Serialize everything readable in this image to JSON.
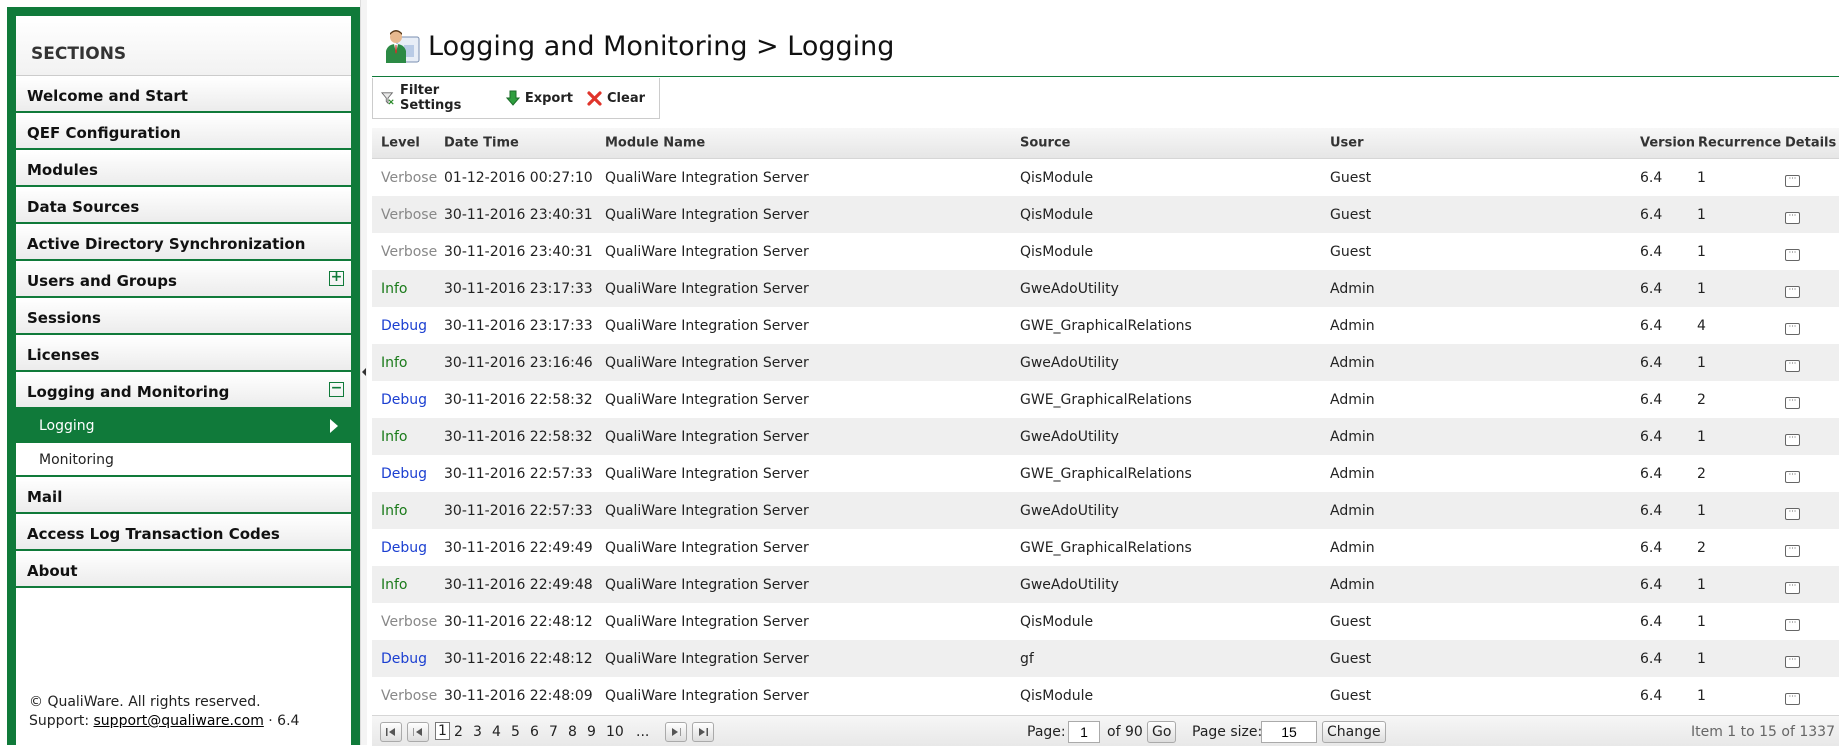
{
  "sidebar": {
    "header": "SECTIONS",
    "items": [
      {
        "label": "Welcome and Start"
      },
      {
        "label": "QEF Configuration"
      },
      {
        "label": "Modules"
      },
      {
        "label": "Data Sources"
      },
      {
        "label": "Active Directory Synchronization"
      },
      {
        "label": "Users and Groups",
        "toggle": "+"
      },
      {
        "label": "Sessions"
      },
      {
        "label": "Licenses"
      },
      {
        "label": "Logging and Monitoring",
        "toggle": "−"
      }
    ],
    "subitems": [
      {
        "label": "Logging",
        "active": true
      },
      {
        "label": "Monitoring",
        "active": false
      }
    ],
    "items_after": [
      {
        "label": "Mail"
      },
      {
        "label": "Access Log Transaction Codes"
      },
      {
        "label": "About"
      }
    ],
    "footer_copyright": "© QualiWare. All rights reserved.",
    "footer_support_label": "Support:",
    "footer_email": "support@qualiware.com",
    "footer_version": "· 6.4"
  },
  "page": {
    "title": "Logging and Monitoring > Logging"
  },
  "toolbar": {
    "filter_label": "Filter Settings",
    "export_label": "Export",
    "clear_label": "Clear"
  },
  "grid": {
    "headers": {
      "level": "Level",
      "datetime": "Date Time",
      "module": "Module Name",
      "source": "Source",
      "user": "User",
      "version": "Version",
      "recurrence": "Recurrence",
      "details": "Details"
    },
    "rows": [
      {
        "level": "Verbose",
        "datetime": "01-12-2016 00:27:10",
        "module": "QualiWare Integration Server",
        "source": "QisModule",
        "user": "Guest",
        "version": "6.4",
        "recurrence": "1"
      },
      {
        "level": "Verbose",
        "datetime": "30-11-2016 23:40:31",
        "module": "QualiWare Integration Server",
        "source": "QisModule",
        "user": "Guest",
        "version": "6.4",
        "recurrence": "1"
      },
      {
        "level": "Verbose",
        "datetime": "30-11-2016 23:40:31",
        "module": "QualiWare Integration Server",
        "source": "QisModule",
        "user": "Guest",
        "version": "6.4",
        "recurrence": "1"
      },
      {
        "level": "Info",
        "datetime": "30-11-2016 23:17:33",
        "module": "QualiWare Integration Server",
        "source": "GweAdoUtility",
        "user": "Admin",
        "version": "6.4",
        "recurrence": "1"
      },
      {
        "level": "Debug",
        "datetime": "30-11-2016 23:17:33",
        "module": "QualiWare Integration Server",
        "source": "GWE_GraphicalRelations",
        "user": "Admin",
        "version": "6.4",
        "recurrence": "4"
      },
      {
        "level": "Info",
        "datetime": "30-11-2016 23:16:46",
        "module": "QualiWare Integration Server",
        "source": "GweAdoUtility",
        "user": "Admin",
        "version": "6.4",
        "recurrence": "1"
      },
      {
        "level": "Debug",
        "datetime": "30-11-2016 22:58:32",
        "module": "QualiWare Integration Server",
        "source": "GWE_GraphicalRelations",
        "user": "Admin",
        "version": "6.4",
        "recurrence": "2"
      },
      {
        "level": "Info",
        "datetime": "30-11-2016 22:58:32",
        "module": "QualiWare Integration Server",
        "source": "GweAdoUtility",
        "user": "Admin",
        "version": "6.4",
        "recurrence": "1"
      },
      {
        "level": "Debug",
        "datetime": "30-11-2016 22:57:33",
        "module": "QualiWare Integration Server",
        "source": "GWE_GraphicalRelations",
        "user": "Admin",
        "version": "6.4",
        "recurrence": "2"
      },
      {
        "level": "Info",
        "datetime": "30-11-2016 22:57:33",
        "module": "QualiWare Integration Server",
        "source": "GweAdoUtility",
        "user": "Admin",
        "version": "6.4",
        "recurrence": "1"
      },
      {
        "level": "Debug",
        "datetime": "30-11-2016 22:49:49",
        "module": "QualiWare Integration Server",
        "source": "GWE_GraphicalRelations",
        "user": "Admin",
        "version": "6.4",
        "recurrence": "2"
      },
      {
        "level": "Info",
        "datetime": "30-11-2016 22:49:48",
        "module": "QualiWare Integration Server",
        "source": "GweAdoUtility",
        "user": "Admin",
        "version": "6.4",
        "recurrence": "1"
      },
      {
        "level": "Verbose",
        "datetime": "30-11-2016 22:48:12",
        "module": "QualiWare Integration Server",
        "source": "QisModule",
        "user": "Guest",
        "version": "6.4",
        "recurrence": "1"
      },
      {
        "level": "Debug",
        "datetime": "30-11-2016 22:48:12",
        "module": "QualiWare Integration Server",
        "source": "gf",
        "user": "Guest",
        "version": "6.4",
        "recurrence": "1"
      },
      {
        "level": "Verbose",
        "datetime": "30-11-2016 22:48:09",
        "module": "QualiWare Integration Server",
        "source": "QisModule",
        "user": "Guest",
        "version": "6.4",
        "recurrence": "1"
      }
    ]
  },
  "pager": {
    "pages": [
      "1",
      "2",
      "3",
      "4",
      "5",
      "6",
      "7",
      "8",
      "9",
      "10",
      "..."
    ],
    "current_page": "1",
    "page_label": "Page:",
    "page_value": "1",
    "of_label": "of 90",
    "go_label": "Go",
    "page_size_label": "Page size:",
    "page_size_value": "15",
    "change_label": "Change",
    "summary": "Item 1 to 15 of 1337"
  },
  "colors": {
    "brand_green": "#107a3a",
    "level_verbose": "#888888",
    "level_info": "#1a7a1a",
    "level_debug": "#1b3fd1"
  }
}
